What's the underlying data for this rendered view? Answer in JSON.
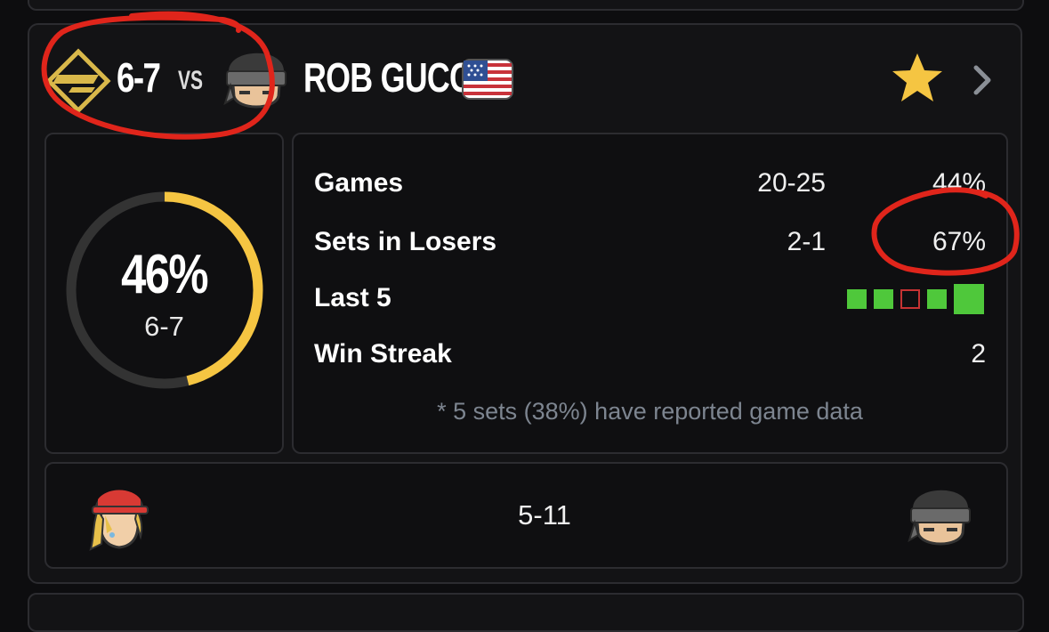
{
  "header": {
    "record": "6-7",
    "vs": "VS",
    "opponent_name": "ROB GUCCI",
    "flag": "us-flag-icon",
    "favorite_icon": "star-icon",
    "open_icon": "chevron-right-icon"
  },
  "ring": {
    "percent_text": "46%",
    "record": "6-7",
    "fill_fraction": 0.46,
    "track_color": "#333333",
    "fill_color": "#f5c542"
  },
  "stats": {
    "rows": [
      {
        "label": "Games",
        "value": "20-25",
        "pct": "44%"
      },
      {
        "label": "Sets in Losers",
        "value": "2-1",
        "pct": "67%"
      },
      {
        "label": "Last 5"
      },
      {
        "label": "Win Streak",
        "value": "2"
      }
    ],
    "last5": [
      "W",
      "W",
      "L",
      "W",
      "W"
    ],
    "note": "* 5 sets (38%) have reported game data"
  },
  "matchup": {
    "score": "5-11",
    "left_icon": "blonde-fighter-cap-icon",
    "right_icon": "headband-fighter-icon"
  },
  "colors": {
    "accent": "#f5c542",
    "win": "#4fc83b",
    "loss": "#c63333",
    "annotation": "#e0251b"
  }
}
